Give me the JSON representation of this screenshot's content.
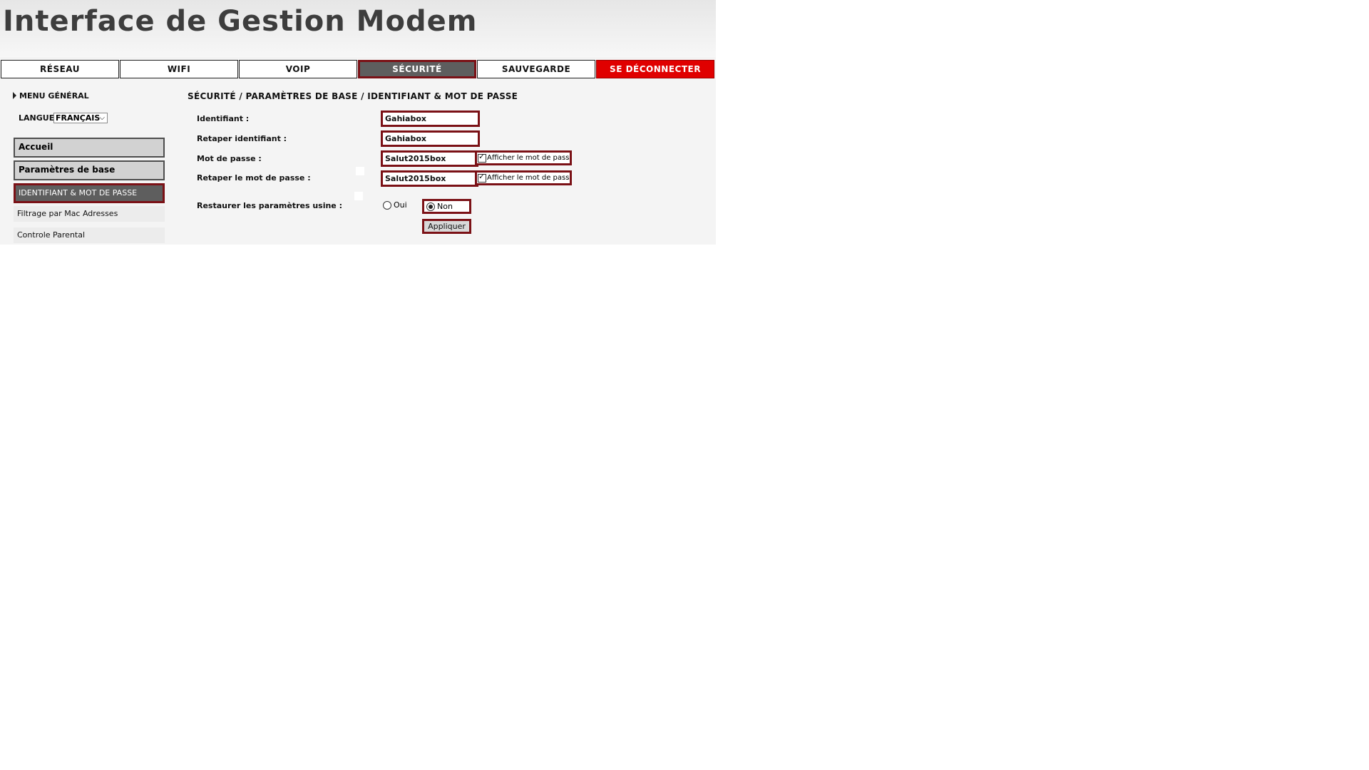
{
  "header": {
    "title": "Interface de Gestion Modem"
  },
  "tabs": [
    {
      "label": "RÉSEAU",
      "state": "normal"
    },
    {
      "label": "WIFI",
      "state": "normal"
    },
    {
      "label": "VOIP",
      "state": "normal"
    },
    {
      "label": "SÉCURITÉ",
      "state": "active"
    },
    {
      "label": "SAUVEGARDE",
      "state": "normal"
    },
    {
      "label": "SE DÉCONNECTER",
      "state": "danger"
    }
  ],
  "sidebar": {
    "menu_title": "MENU GÉNÉRAL",
    "language_label": "LANGUE",
    "language_value": "FRANÇAIS",
    "items": [
      {
        "label": "Accueil"
      },
      {
        "label": "Paramètres de base"
      },
      {
        "label": "IDENTIFIANT & MOT DE PASSE"
      },
      {
        "label": "Filtrage par Mac Adresses"
      },
      {
        "label": "Controle Parental"
      }
    ]
  },
  "content": {
    "breadcrumb": "SÉCURITÉ / PARAMÈTRES DE BASE / IDENTIFIANT & MOT DE PASSE",
    "identifiant_label": "Identifiant :",
    "identifiant_value": "Gahiabox",
    "retaper_identifiant_label": "Retaper identifiant :",
    "retaper_identifiant_value": "Gahiabox",
    "mot_de_passe_label": "Mot de passe :",
    "mot_de_passe_value": "Salut2015box",
    "retaper_mot_de_passe_label": "Retaper le mot de passe :",
    "retaper_mot_de_passe_value": "Salut2015box",
    "show_password_label": "Afficher le mot de passe",
    "restore_label": "Restaurer les paramètres usine :",
    "restore_yes": "Oui",
    "restore_no": "Non",
    "apply_label": "Appliquer"
  },
  "colors": {
    "accent_border": "#7b1116",
    "active_bg": "#5e5e5e",
    "danger": "#e00000"
  },
  "icons": {
    "menu_arrow": "triangle-right-icon",
    "select_chevron": "chevron-down-icon",
    "checkbox": "checkbox-checked-icon"
  }
}
